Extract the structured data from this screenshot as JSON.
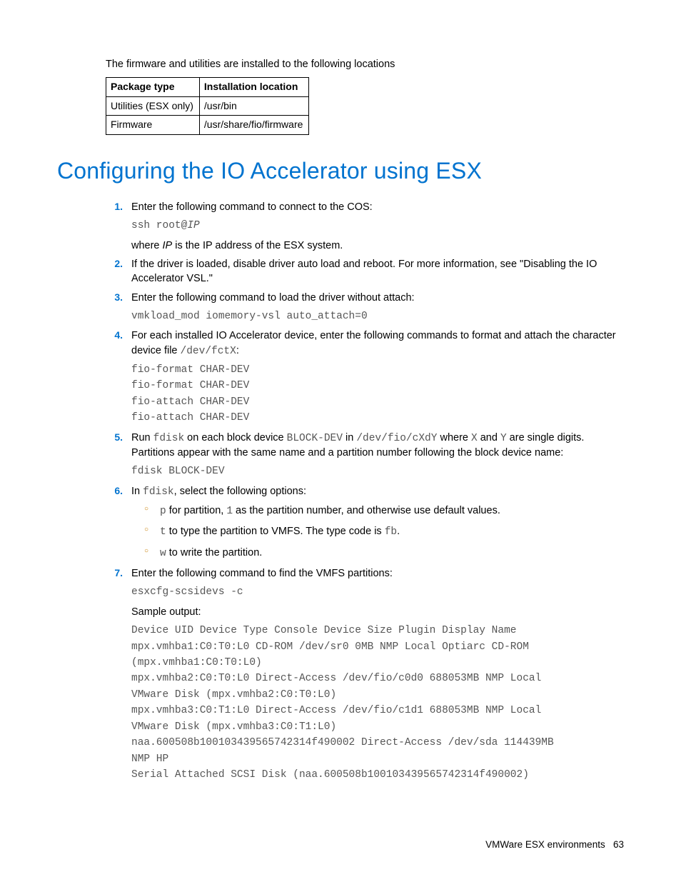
{
  "intro": "The firmware and utilities are installed to the following locations",
  "table": {
    "headers": [
      "Package type",
      "Installation location"
    ],
    "rows": [
      [
        "Utilities (ESX only)",
        "/usr/bin"
      ],
      [
        "Firmware",
        "/usr/share/fio/firmware"
      ]
    ]
  },
  "heading": "Configuring the IO Accelerator using ESX",
  "steps": {
    "s1": {
      "text": "Enter the following command to connect to the COS:",
      "code_prefix": "ssh root@",
      "code_italic": "IP",
      "where_pre": "where ",
      "where_ip": "IP",
      "where_post": " is the IP address of the ESX system."
    },
    "s2": {
      "text": "If the driver is loaded, disable driver auto load and reboot. For more information, see \"Disabling the IO Accelerator VSL.\""
    },
    "s3": {
      "text": "Enter the following command to load the driver without attach:",
      "code": "vmkload_mod iomemory-vsl auto_attach=0"
    },
    "s4": {
      "pre": "For each installed IO Accelerator device, enter the following commands to format and attach the character device file ",
      "inline": "/dev/fctX",
      "post": ":",
      "code": "fio-format CHAR-DEV\nfio-format CHAR-DEV\nfio-attach CHAR-DEV\nfio-attach CHAR-DEV"
    },
    "s5": {
      "p1": "Run ",
      "c1": "fdisk",
      "p2": " on each block device ",
      "c2": "BLOCK-DEV",
      "p3": " in ",
      "c3": "/dev/fio/cXdY",
      "p4": "  where ",
      "c4": "X",
      "p5": " and ",
      "c5": "Y",
      "p6": " are single digits. Partitions appear with the same name and a partition number following the block device name:",
      "code": "fdisk BLOCK-DEV"
    },
    "s6": {
      "p1": "In ",
      "c1": "fdisk",
      "p2": ", select the following options:",
      "items": {
        "a": {
          "c1": "p",
          "t1": " for partition, ",
          "c2": "1",
          "t2": " as the partition number, and otherwise use default values."
        },
        "b": {
          "c1": "t",
          "t1": " to type the partition to VMFS. The type code is ",
          "c2": "fb",
          "t2": "."
        },
        "c": {
          "c1": "w",
          "t1": " to write the partition."
        }
      }
    },
    "s7": {
      "text": "Enter the following command to find the VMFS partitions:",
      "code": "esxcfg-scsidevs -c",
      "sample_label": "Sample output:",
      "sample": "Device UID Device Type Console Device Size Plugin Display Name\nmpx.vmhba1:C0:T0:L0 CD-ROM /dev/sr0 0MB NMP Local Optiarc CD-ROM\n(mpx.vmhba1:C0:T0:L0)\nmpx.vmhba2:C0:T0:L0 Direct-Access /dev/fio/c0d0 688053MB NMP Local\nVMware Disk (mpx.vmhba2:C0:T0:L0)\nmpx.vmhba3:C0:T1:L0 Direct-Access /dev/fio/c1d1 688053MB NMP Local\nVMware Disk (mpx.vmhba3:C0:T1:L0)\nnaa.600508b100103439565742314f490002 Direct-Access /dev/sda 114439MB\nNMP HP\nSerial Attached SCSI Disk (naa.600508b100103439565742314f490002)"
    }
  },
  "footer": {
    "section": "VMWare ESX environments",
    "page": "63"
  }
}
